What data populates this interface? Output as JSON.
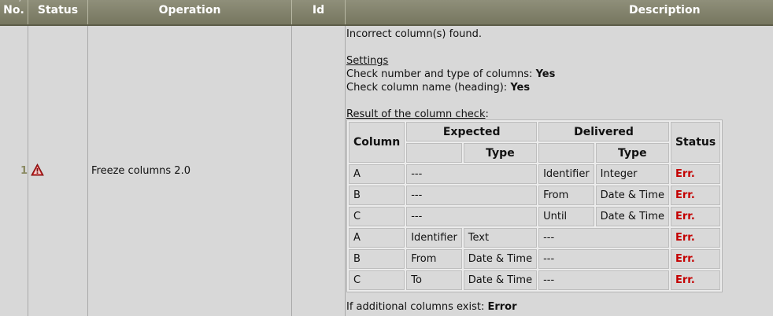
{
  "header": {
    "corner_glyph": "°/",
    "no": "No.",
    "status": "Status",
    "operation": "Operation",
    "id": "Id",
    "description": "Description"
  },
  "row": {
    "number": "1",
    "status_icon": "warning-triangle-icon",
    "operation": "Freeze columns 2.0",
    "id": ""
  },
  "description": {
    "line1": "Incorrect column(s) found.",
    "settings_heading": "Settings",
    "check1_label": "Check number and type of columns: ",
    "check1_value": "Yes",
    "check2_label": "Check column name (heading): ",
    "check2_value": "Yes",
    "result_heading": "Result of the column check",
    "result_colon": ":",
    "footer_label": "If additional columns exist: ",
    "footer_value": "Error"
  },
  "check_table": {
    "head": {
      "column": "Column",
      "expected": "Expected",
      "delivered": "Delivered",
      "status": "Status",
      "type": "Type",
      "type2": "Type"
    },
    "rows": [
      {
        "column": "A",
        "exp_name": "---",
        "exp_type": "",
        "del_name": "Identifier",
        "del_type": "Integer",
        "status": "Err."
      },
      {
        "column": "B",
        "exp_name": "---",
        "exp_type": "",
        "del_name": "From",
        "del_type": "Date & Time",
        "status": "Err."
      },
      {
        "column": "C",
        "exp_name": "---",
        "exp_type": "",
        "del_name": "Until",
        "del_type": "Date & Time",
        "status": "Err."
      },
      {
        "column": "A",
        "exp_name": "Identifier",
        "exp_type": "Text",
        "del_name": "---",
        "del_type": "",
        "status": "Err."
      },
      {
        "column": "B",
        "exp_name": "From",
        "exp_type": "Date & Time",
        "del_name": "---",
        "del_type": "",
        "status": "Err."
      },
      {
        "column": "C",
        "exp_name": "To",
        "exp_type": "Date & Time",
        "del_name": "---",
        "del_type": "",
        "status": "Err."
      }
    ]
  },
  "colors": {
    "header_bg": "#7f7f68",
    "body_bg": "#d8d8d8",
    "error_red": "#c40000",
    "row_number": "#8a8a62"
  }
}
